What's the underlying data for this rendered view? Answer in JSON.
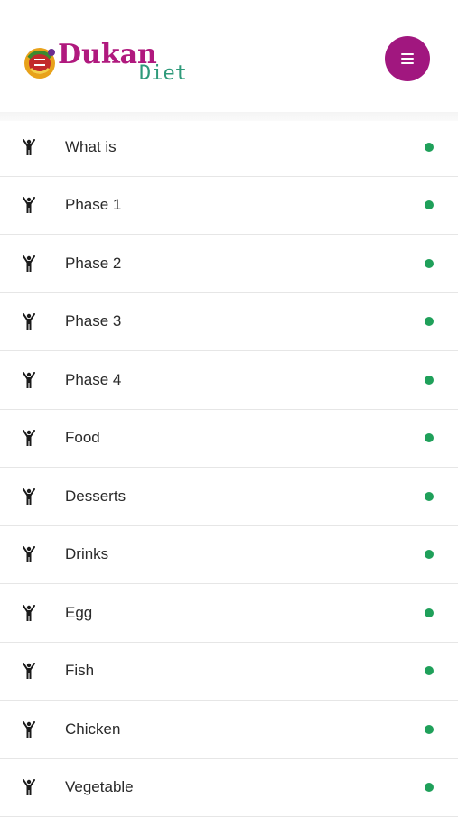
{
  "header": {
    "logo_primary": "Dukan",
    "logo_secondary": "Diet",
    "menu_icon": "hamburger-menu-icon"
  },
  "colors": {
    "brand": "#a1177f",
    "logo_text": "#b0197e",
    "logo_sub": "#2e9a7a",
    "status": "#1fa05a"
  },
  "menu": {
    "item_icon": "person-arms-raised-icon",
    "items": [
      {
        "label": "What is"
      },
      {
        "label": "Phase 1"
      },
      {
        "label": "Phase 2"
      },
      {
        "label": "Phase 3"
      },
      {
        "label": "Phase 4"
      },
      {
        "label": "Food"
      },
      {
        "label": "Desserts"
      },
      {
        "label": "Drinks"
      },
      {
        "label": "Egg"
      },
      {
        "label": "Fish"
      },
      {
        "label": "Chicken"
      },
      {
        "label": "Vegetable"
      }
    ]
  }
}
